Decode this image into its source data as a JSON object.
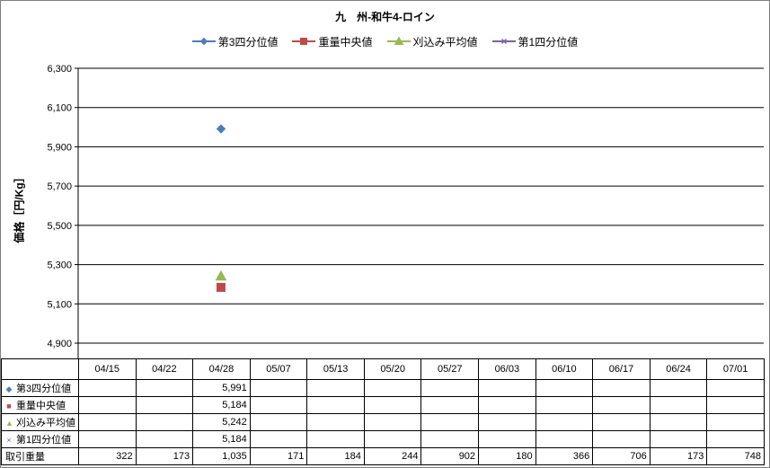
{
  "chart_data": {
    "type": "line",
    "title": "九　州-和牛4-ロイン",
    "xlabel": "",
    "ylabel": "価格［円/Kg］",
    "ylim": [
      4900,
      6300
    ],
    "yticks": [
      "4,900",
      "5,100",
      "5,300",
      "5,500",
      "5,700",
      "5,900",
      "6,100",
      "6,300"
    ],
    "grid": "horizontal",
    "legend_position": "top",
    "categories": [
      "04/15",
      "04/22",
      "04/28",
      "05/07",
      "05/13",
      "05/20",
      "05/27",
      "06/03",
      "06/10",
      "06/17",
      "06/24",
      "07/01"
    ],
    "series": [
      {
        "name": "第3四分位値",
        "values": [
          null,
          null,
          5991,
          null,
          null,
          null,
          null,
          null,
          null,
          null,
          null,
          null
        ],
        "color": "#4a7ebb",
        "marker": "diamond",
        "label_values": [
          "",
          "",
          "5,991",
          "",
          "",
          "",
          "",
          "",
          "",
          "",
          "",
          ""
        ]
      },
      {
        "name": "重量中央値",
        "values": [
          null,
          null,
          5184,
          null,
          null,
          null,
          null,
          null,
          null,
          null,
          null,
          null
        ],
        "color": "#be4b48",
        "marker": "square",
        "label_values": [
          "",
          "",
          "5,184",
          "",
          "",
          "",
          "",
          "",
          "",
          "",
          "",
          ""
        ]
      },
      {
        "name": "刈込み平均値",
        "values": [
          null,
          null,
          5242,
          null,
          null,
          null,
          null,
          null,
          null,
          null,
          null,
          null
        ],
        "color": "#98b954",
        "marker": "triangle",
        "label_values": [
          "",
          "",
          "5,242",
          "",
          "",
          "",
          "",
          "",
          "",
          "",
          "",
          ""
        ]
      },
      {
        "name": "第1四分位値",
        "values": [
          null,
          null,
          5184,
          null,
          null,
          null,
          null,
          null,
          null,
          null,
          null,
          null
        ],
        "color": "#7d60a0",
        "marker": "x",
        "label_values": [
          "",
          "",
          "5,184",
          "",
          "",
          "",
          "",
          "",
          "",
          "",
          "",
          ""
        ]
      }
    ],
    "volume": {
      "name": "取引重量",
      "values": [
        "322",
        "173",
        "1,035",
        "171",
        "184",
        "244",
        "902",
        "180",
        "366",
        "706",
        "173",
        "748"
      ]
    }
  }
}
